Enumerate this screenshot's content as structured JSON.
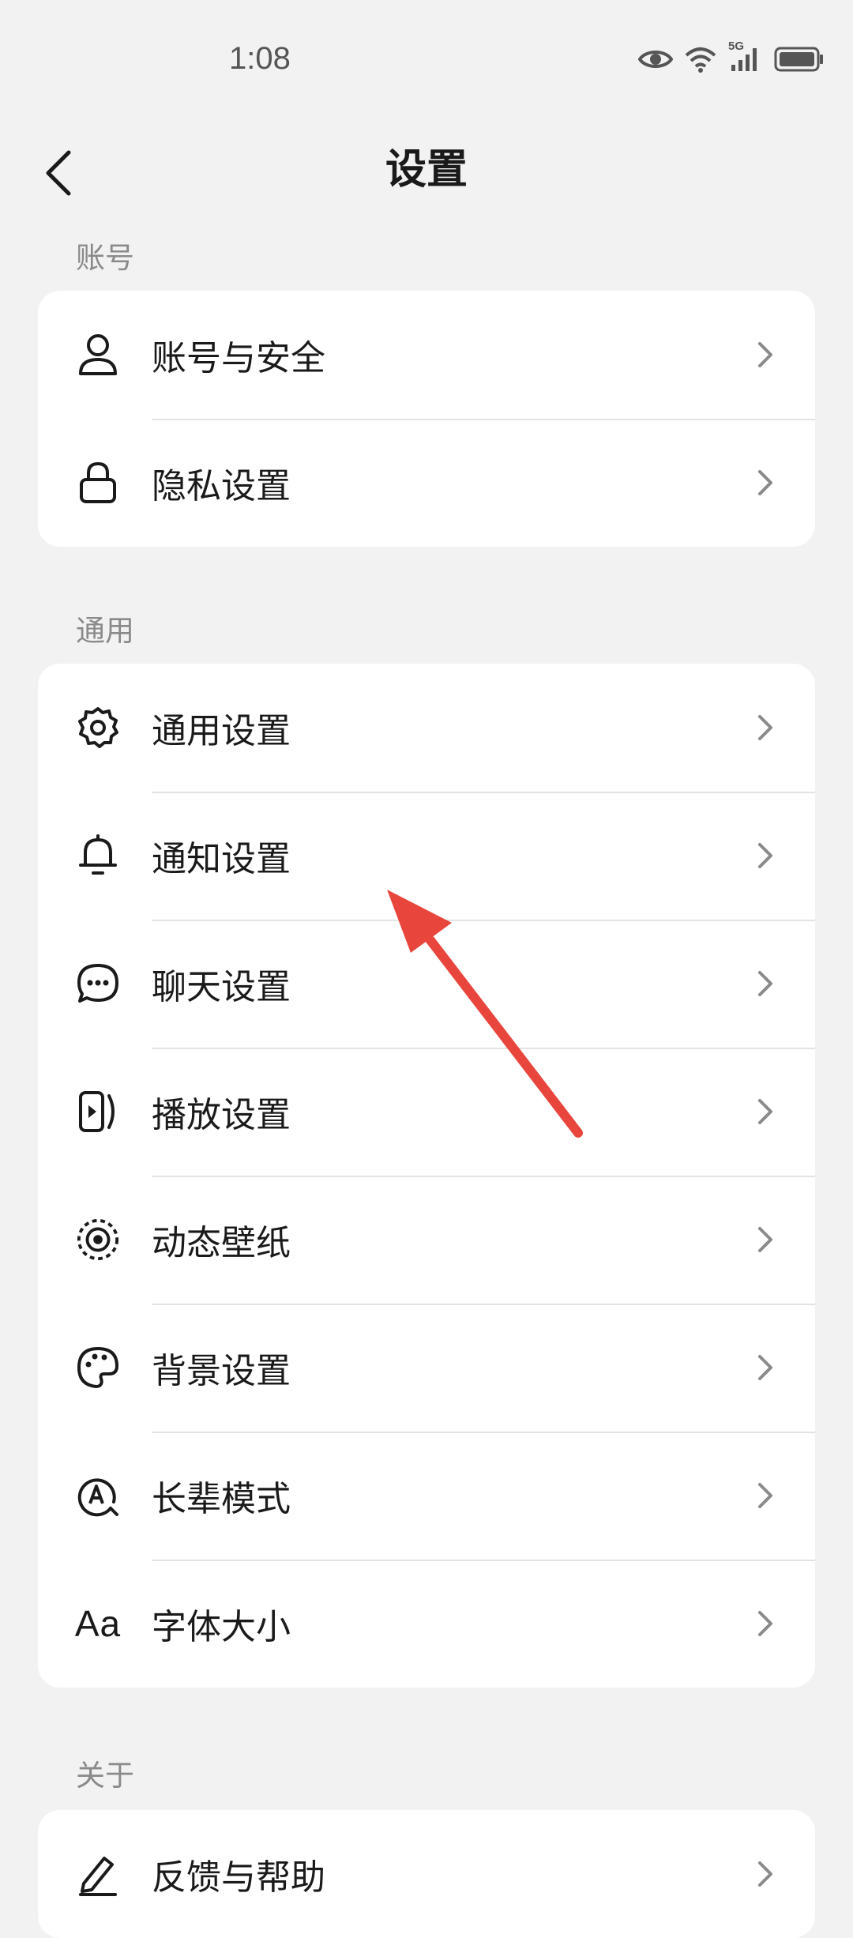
{
  "status_bar": {
    "time": "1:08",
    "network": "5G"
  },
  "header": {
    "title": "设置"
  },
  "sections": {
    "account": {
      "label": "账号",
      "items": [
        {
          "label": "账号与安全",
          "icon": "person-icon"
        },
        {
          "label": "隐私设置",
          "icon": "lock-icon"
        }
      ]
    },
    "general": {
      "label": "通用",
      "items": [
        {
          "label": "通用设置",
          "icon": "gear-icon"
        },
        {
          "label": "通知设置",
          "icon": "bell-icon"
        },
        {
          "label": "聊天设置",
          "icon": "chat-bubble-icon"
        },
        {
          "label": "播放设置",
          "icon": "play-icon"
        },
        {
          "label": "动态壁纸",
          "icon": "wallpaper-icon"
        },
        {
          "label": "背景设置",
          "icon": "palette-icon"
        },
        {
          "label": "长辈模式",
          "icon": "elder-mode-icon"
        },
        {
          "label": "字体大小",
          "icon": "font-size-icon",
          "icon_text": "Aa"
        }
      ]
    },
    "about": {
      "label": "关于",
      "items": [
        {
          "label": "反馈与帮助",
          "icon": "pencil-icon"
        }
      ]
    }
  },
  "colors": {
    "background": "#f2f2f2",
    "card": "#ffffff",
    "annotation": "#e8453c",
    "section_label": "#8a8a8a",
    "chevron": "#8a8a8a"
  }
}
